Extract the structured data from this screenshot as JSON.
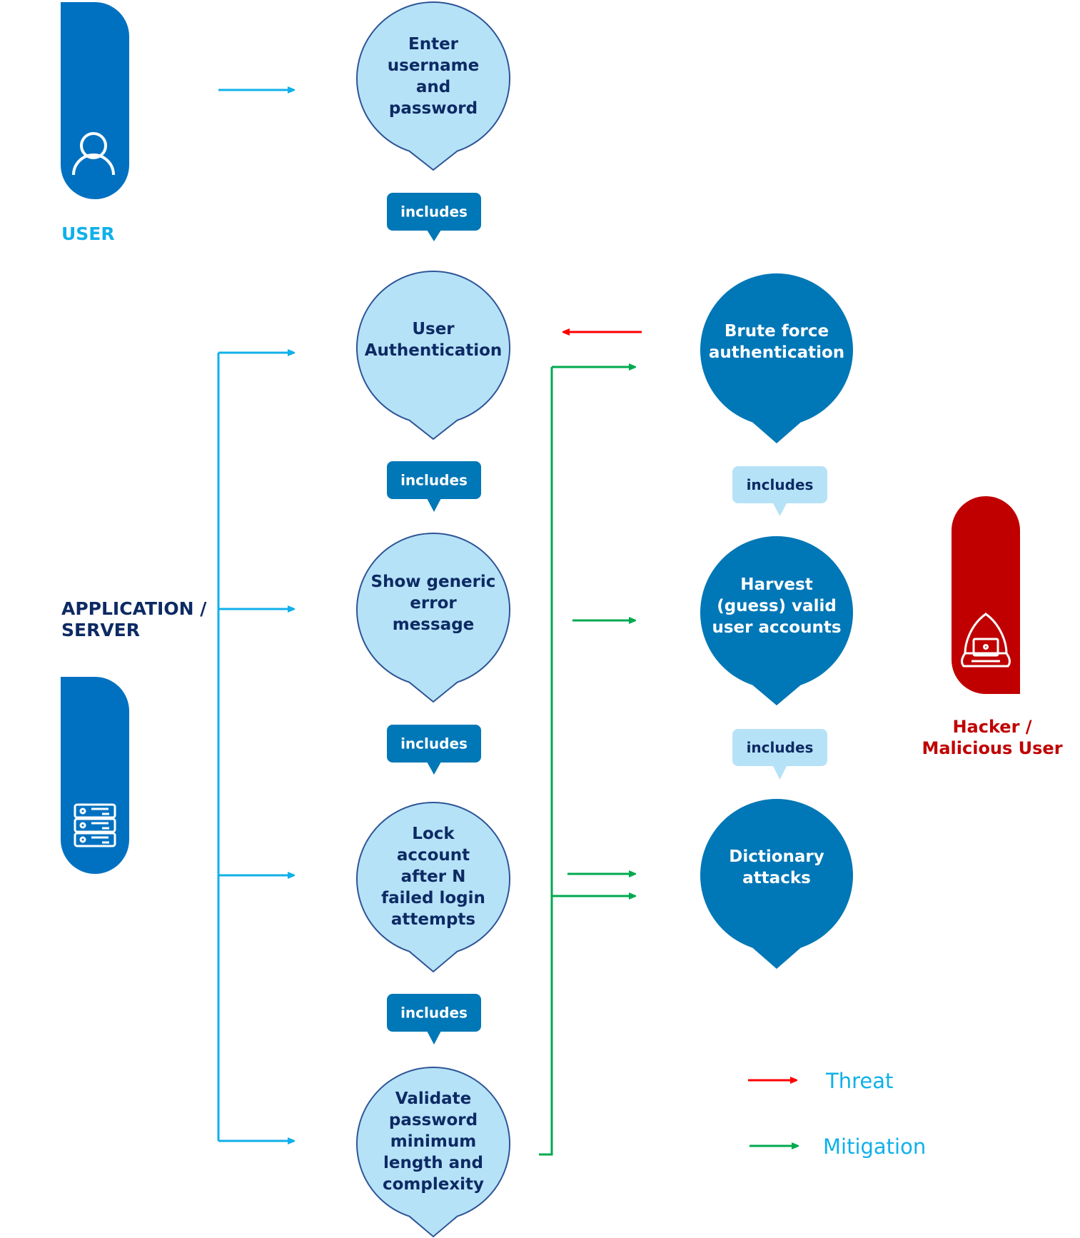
{
  "colors": {
    "user_blue": "#0071c1",
    "bubble_light": "#b6e2f8",
    "bubble_light_stroke": "#2e5596",
    "bubble_dark": "#0077b6",
    "text_navy": "#0d2a63",
    "flow_blue": "#10b0ea",
    "threat_red": "#ff0000",
    "mitigation_green": "#00aa4f",
    "hacker_red": "#c00000"
  },
  "actors": {
    "user": {
      "label": "USER",
      "icon": "user-icon"
    },
    "server": {
      "label_line1": "APPLICATION /",
      "label_line2": "SERVER",
      "icon": "server-icon"
    },
    "hacker": {
      "label_line1": "Hacker /",
      "label_line2": "Malicious User",
      "icon": "hacker-laptop-icon"
    }
  },
  "use_cases": [
    {
      "id": "enter-credentials",
      "lines": [
        "Enter",
        "username",
        "and",
        "password"
      ]
    },
    {
      "id": "user-authentication",
      "lines": [
        "User",
        "Authentication"
      ]
    },
    {
      "id": "generic-error",
      "lines": [
        "Show generic",
        "error",
        "message"
      ]
    },
    {
      "id": "lock-account",
      "lines": [
        "Lock",
        "account",
        "after N",
        "failed login",
        "attempts"
      ]
    },
    {
      "id": "validate-password",
      "lines": [
        "Validate",
        "password",
        "minimum",
        "length and",
        "complexity"
      ]
    }
  ],
  "threats": [
    {
      "id": "brute-force",
      "lines": [
        "Brute force",
        "authentication"
      ]
    },
    {
      "id": "harvest-accounts",
      "lines": [
        "Harvest",
        "(guess) valid",
        "user accounts"
      ]
    },
    {
      "id": "dictionary-attacks",
      "lines": [
        "Dictionary",
        "attacks"
      ]
    }
  ],
  "relations": {
    "includes_label": "includes"
  },
  "legend": {
    "threat_label": "Threat",
    "mitigation_label": "Mitigation"
  }
}
